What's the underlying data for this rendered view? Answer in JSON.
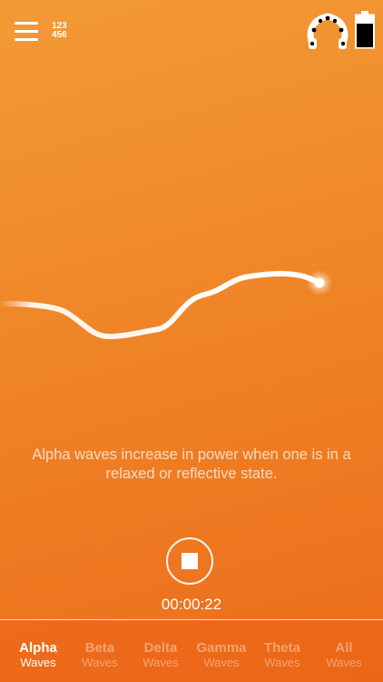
{
  "header": {
    "menu_icon": "hamburger-menu-icon",
    "numbers_line1": "123",
    "numbers_line2": "456",
    "headset_icon": "eeg-headset-icon",
    "battery_icon": "battery-icon"
  },
  "main": {
    "description": "Alpha waves increase in power when one is in a relaxed or reflective state.",
    "stop_icon": "stop-icon",
    "timer": "00:00:22"
  },
  "tabs": [
    {
      "name": "Alpha",
      "sub": "Waves",
      "active": true
    },
    {
      "name": "Beta",
      "sub": "Waves",
      "active": false
    },
    {
      "name": "Delta",
      "sub": "Waves",
      "active": false
    },
    {
      "name": "Gamma",
      "sub": "Waves",
      "active": false
    },
    {
      "name": "Theta",
      "sub": "Waves",
      "active": false
    },
    {
      "name": "All",
      "sub": "Waves",
      "active": false
    }
  ],
  "colors": {
    "background_top": "#f29a36",
    "background_bottom": "#ec6c1a",
    "wave": "#ffffff",
    "tab_active": "#ffffff",
    "tab_inactive": "#f7b27f"
  }
}
